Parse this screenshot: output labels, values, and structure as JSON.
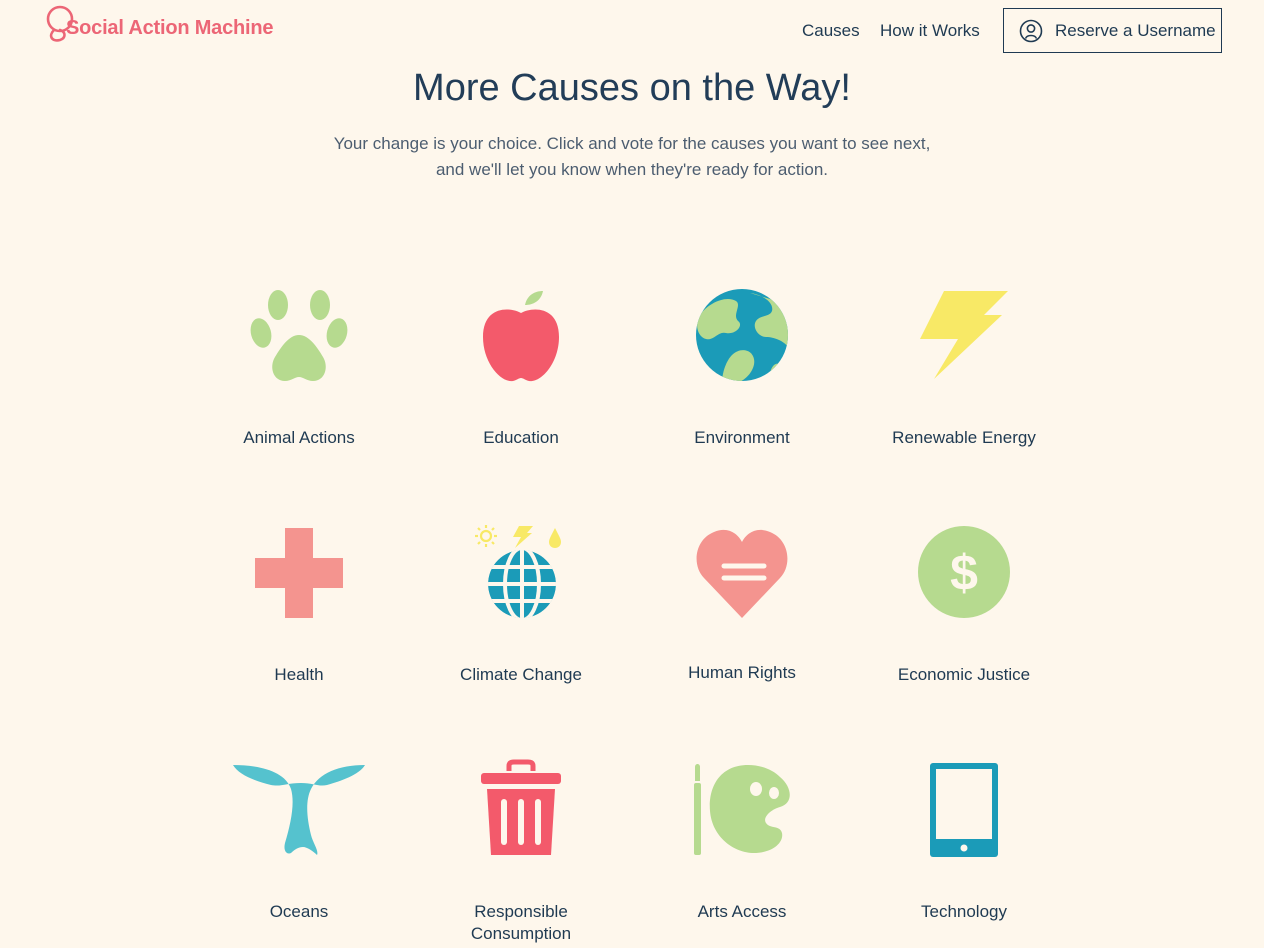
{
  "brand": {
    "name": "Social Action Machine",
    "color": "#ec6676"
  },
  "nav": {
    "causes": "Causes",
    "how_it_works": "How it Works",
    "reserve": "Reserve a Username"
  },
  "hero": {
    "title": "More Causes on the Way!",
    "subtitle": "Your change is your choice. Click and vote for the causes you want to see next, and we'll let you know when they're ready for action."
  },
  "causes": [
    {
      "label": "Animal Actions",
      "icon": "paw-icon"
    },
    {
      "label": "Education",
      "icon": "apple-icon"
    },
    {
      "label": "Environment",
      "icon": "globe-icon"
    },
    {
      "label": "Renewable Energy",
      "icon": "lightning-icon"
    },
    {
      "label": "Health",
      "icon": "medical-cross-icon"
    },
    {
      "label": "Climate Change",
      "icon": "climate-globe-icon"
    },
    {
      "label": "Human Rights",
      "icon": "heart-icon"
    },
    {
      "label": "Economic Justice",
      "icon": "dollar-icon"
    },
    {
      "label": "Oceans",
      "icon": "whale-tail-icon"
    },
    {
      "label": "Responsible Consumption",
      "icon": "trash-can-icon"
    },
    {
      "label": "Arts Access",
      "icon": "palette-icon"
    },
    {
      "label": "Technology",
      "icon": "tablet-icon"
    }
  ],
  "colors": {
    "background": "#fef7ec",
    "text": "#1f3a52",
    "green": "#b6da8f",
    "red": "#f35a6b",
    "pink": "#f4948f",
    "blue": "#1b9bb8",
    "yellow": "#f8e966",
    "teal": "#55c2ce"
  }
}
